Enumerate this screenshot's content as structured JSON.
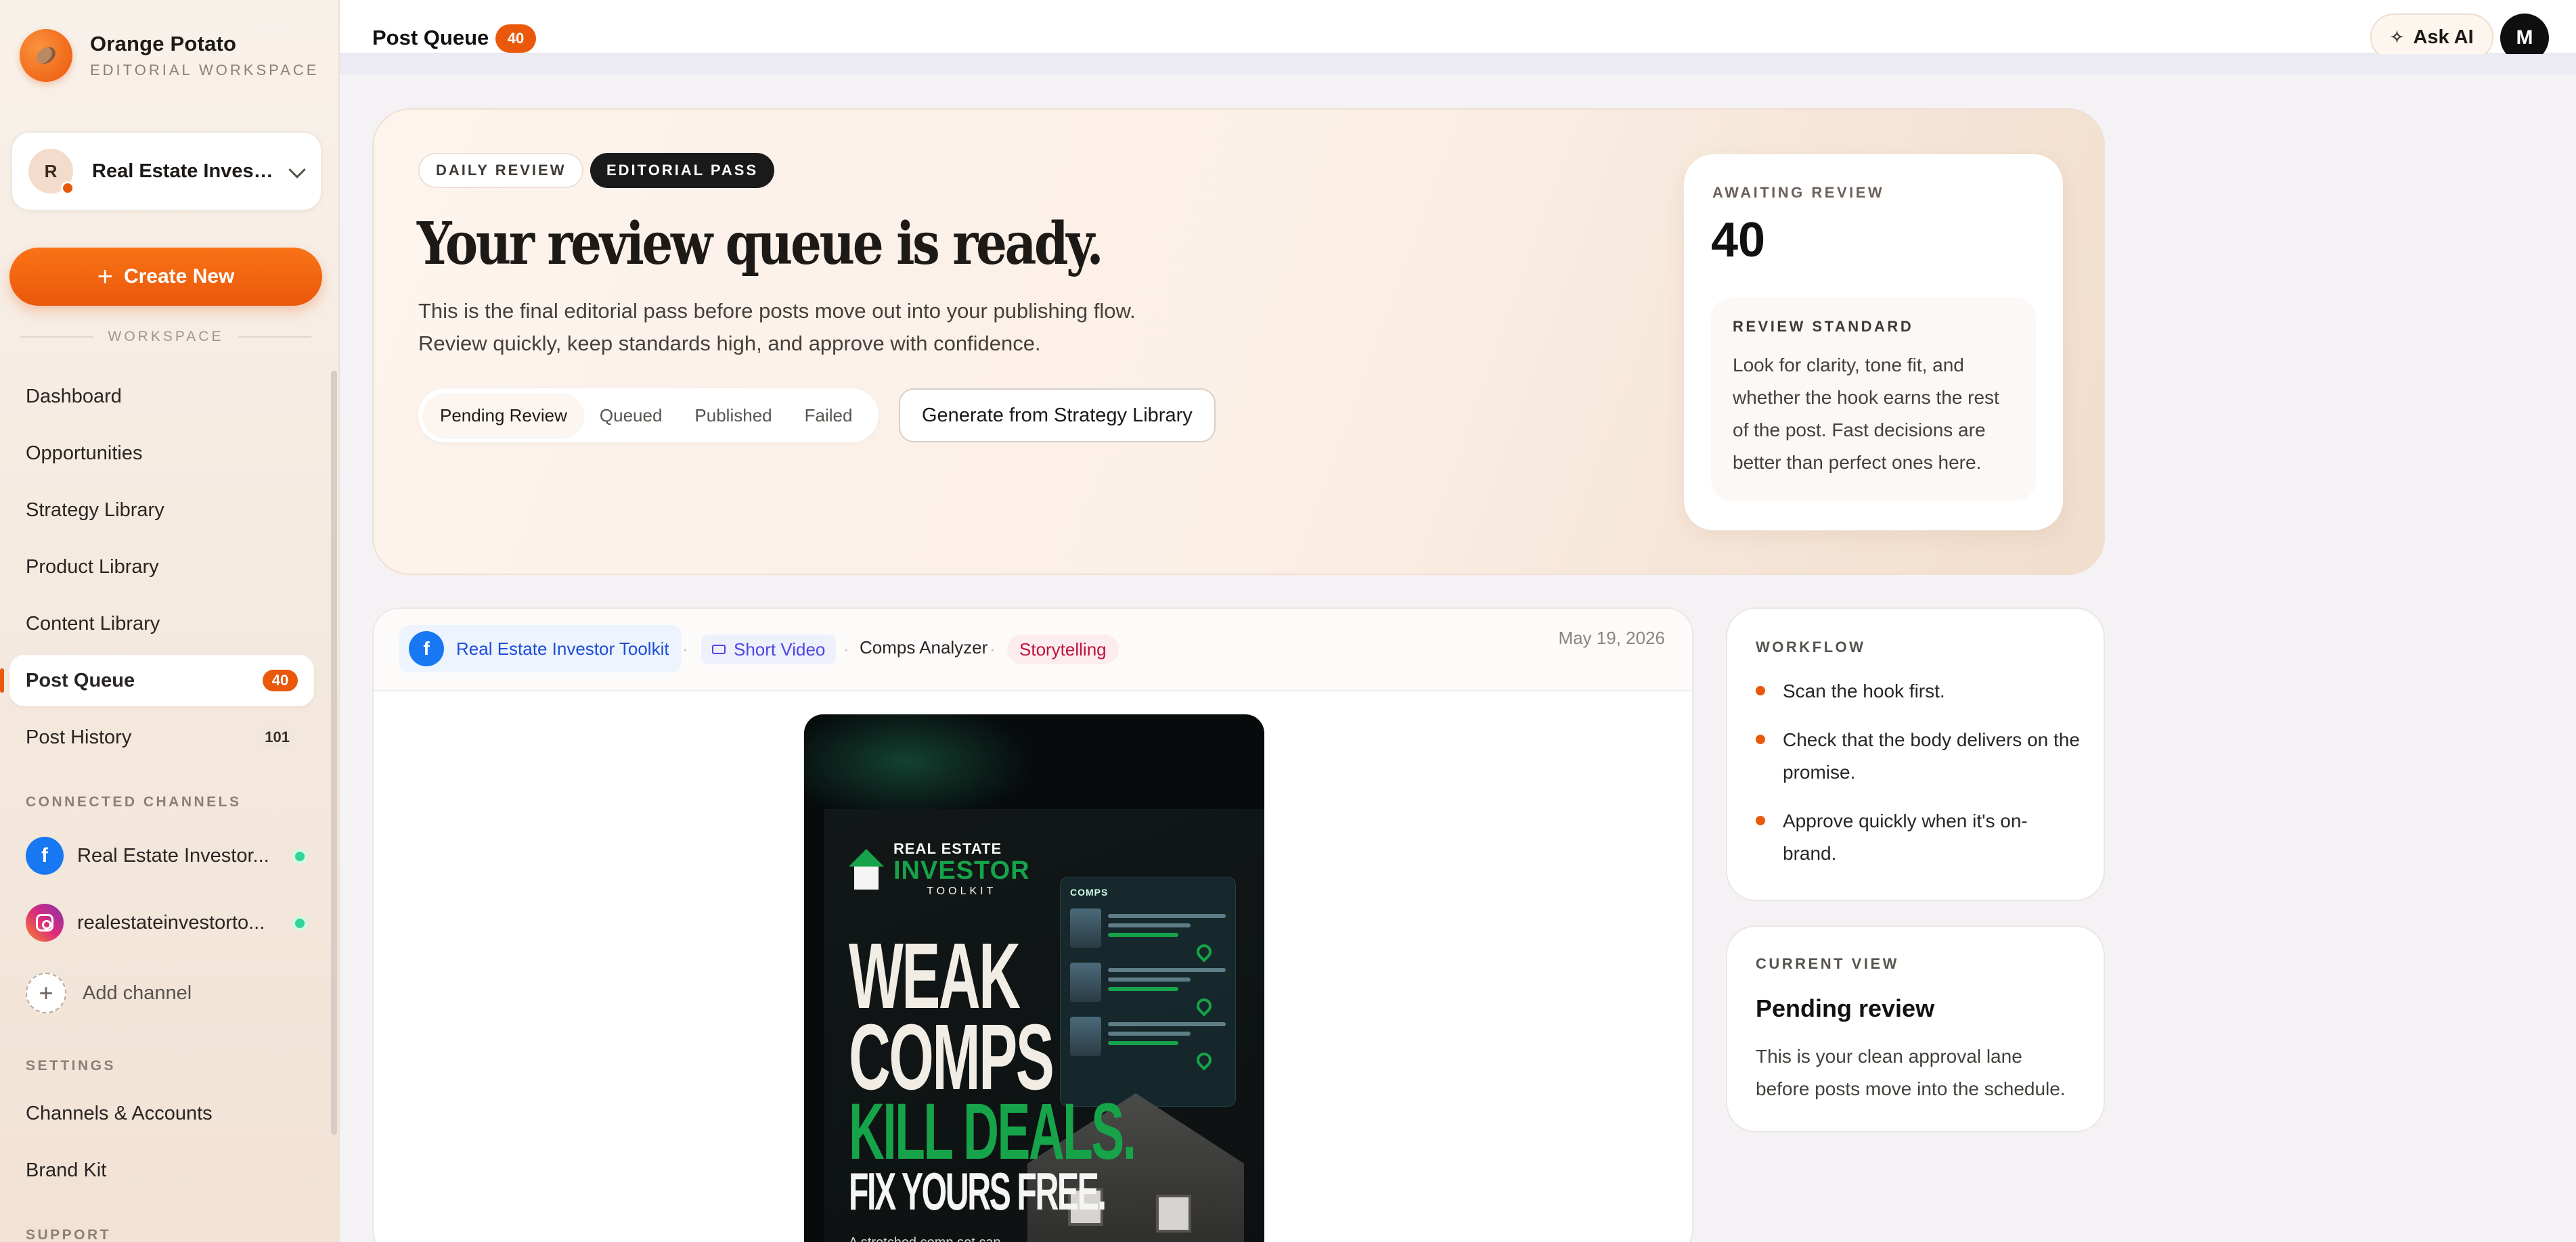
{
  "brand": {
    "name": "Orange Potato",
    "subtitle": "EDITORIAL WORKSPACE"
  },
  "workspace": {
    "initial": "R",
    "name": "Real Estate Invest..."
  },
  "create_button": {
    "label": "Create New"
  },
  "sidebar": {
    "section_workspace": "WORKSPACE",
    "items": [
      {
        "label": "Dashboard"
      },
      {
        "label": "Opportunities"
      },
      {
        "label": "Strategy Library"
      },
      {
        "label": "Product Library"
      },
      {
        "label": "Content Library"
      },
      {
        "label": "Post Queue",
        "count": "40"
      },
      {
        "label": "Post History",
        "count": "101"
      }
    ],
    "section_channels": "CONNECTED CHANNELS",
    "channels": [
      {
        "name": "Real Estate Investor...",
        "icon": "facebook-icon"
      },
      {
        "name": "realestateinvestorto...",
        "icon": "instagram-icon"
      }
    ],
    "add_channel": "Add channel",
    "section_settings": "SETTINGS",
    "settings_items": [
      {
        "label": "Channels & Accounts"
      },
      {
        "label": "Brand Kit"
      }
    ],
    "section_support": "SUPPORT"
  },
  "topbar": {
    "title": "Post Queue",
    "count": "40",
    "ask_ai": "Ask AI",
    "avatar": "M"
  },
  "hero": {
    "pill_daily": "DAILY REVIEW",
    "pill_editorial": "EDITORIAL PASS",
    "title": "Your review queue is ready.",
    "desc_line1": "This is the final editorial pass before posts move out into your publishing flow.",
    "desc_line2": "Review quickly, keep standards high, and approve with confidence.",
    "tabs": [
      "Pending Review",
      "Queued",
      "Published",
      "Failed"
    ],
    "generate_button": "Generate from Strategy Library",
    "awaiting_label": "AWAITING REVIEW",
    "awaiting_count": "40",
    "standard_label": "REVIEW STANDARD",
    "standard_text": "Look for clarity, tone fit, and whether the hook earns the rest of the post. Fast decisions are better than perfect ones here."
  },
  "post": {
    "account": "Real Estate Investor Toolkit",
    "type": "Short Video",
    "product": "Comps Analyzer",
    "tag": "Storytelling",
    "date": "May 19, 2026",
    "creative": {
      "logo_line1": "REAL ESTATE",
      "logo_line2": "INVESTOR",
      "logo_line3": "TOOLKIT",
      "headline1": "WEAK",
      "headline2": "COMPS",
      "headline3": "KILL DEALS.",
      "headline4": "FIX YOURS FREE.",
      "small_text": "A stretched comp set can",
      "panel_label": "COMPS"
    }
  },
  "workflow": {
    "label": "WORKFLOW",
    "items": [
      "Scan the hook first.",
      "Check that the body delivers on the promise.",
      "Approve quickly when it's on-brand."
    ]
  },
  "current_view": {
    "label": "CURRENT VIEW",
    "title": "Pending review",
    "text": "This is your clean approval lane before posts move into the schedule."
  }
}
